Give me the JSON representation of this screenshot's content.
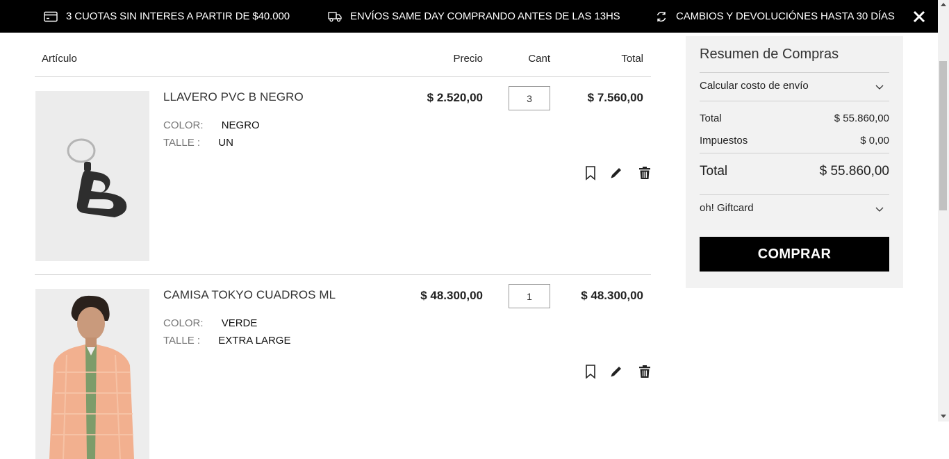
{
  "topbar": {
    "promo1": "3 CUOTAS SIN INTERES A PARTIR DE $40.000",
    "promo2": "ENVÍOS SAME DAY COMPRANDO ANTES DE LAS 13HS",
    "promo3": "CAMBIOS Y DEVOLUCIÓNES HASTA 30 DÍAS",
    "icons": [
      "credit-card-icon",
      "truck-icon",
      "refresh-icon",
      "close-icon"
    ]
  },
  "cart": {
    "headers": {
      "article": "Artículo",
      "price": "Precio",
      "qty": "Cant",
      "total": "Total"
    },
    "items": [
      {
        "name": "LLAVERO PVC B NEGRO",
        "color_label": "COLOR:",
        "color": "NEGRO",
        "size_label": "TALLE :",
        "size": "UN",
        "price": "$ 2.520,00",
        "qty": "3",
        "total": "$ 7.560,00"
      },
      {
        "name": "CAMISA TOKYO CUADROS ML",
        "color_label": "COLOR:",
        "color": "VERDE",
        "size_label": "TALLE :",
        "size": "EXTRA LARGE",
        "price": "$ 48.300,00",
        "qty": "1",
        "total": "$ 48.300,00"
      }
    ],
    "action_icons": [
      "bookmark-icon",
      "pencil-icon",
      "trash-icon"
    ]
  },
  "summary": {
    "title": "Resumen de Compras",
    "shipping_label": "Calcular costo de envío",
    "subtotal_label": "Total",
    "subtotal_value": "$ 55.860,00",
    "tax_label": "Impuestos",
    "tax_value": "$ 0,00",
    "total_label": "Total",
    "total_value": "$ 55.860,00",
    "giftcard_label": "oh! Giftcard",
    "buy_label": "COMPRAR"
  },
  "colors": {
    "topbar_bg": "#000000",
    "summary_bg": "#f2f2f2",
    "button_bg": "#000000"
  }
}
